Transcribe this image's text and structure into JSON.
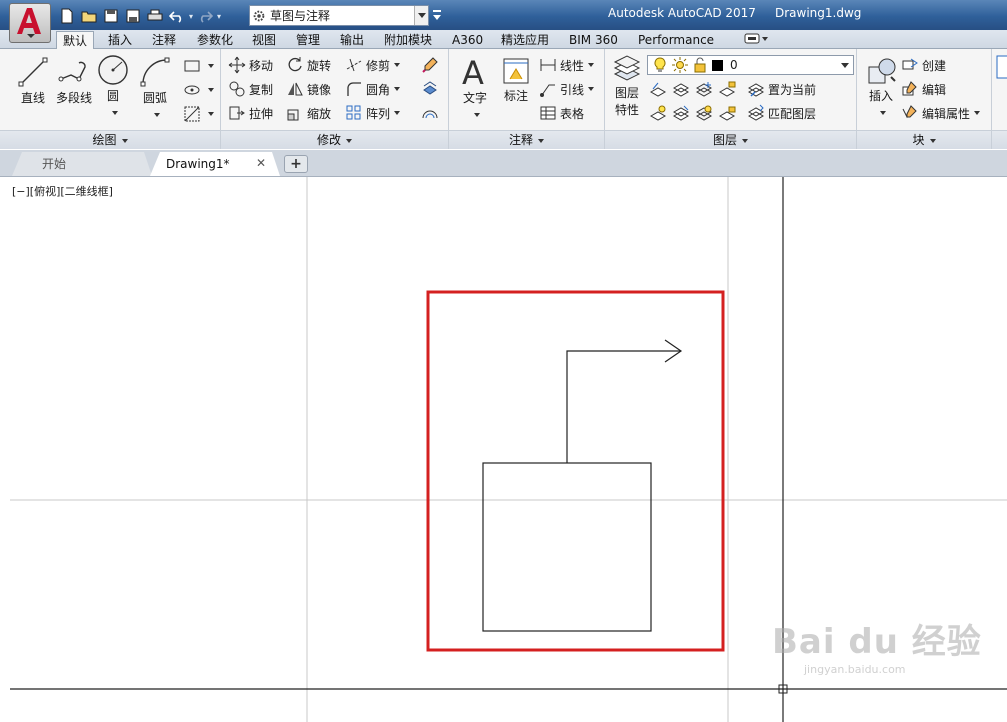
{
  "window": {
    "app_title": "Autodesk AutoCAD 2017",
    "document_title": "Drawing1.dwg"
  },
  "workspace": {
    "value": "草图与注释"
  },
  "ribbon_tabs": [
    "默认",
    "插入",
    "注释",
    "参数化",
    "视图",
    "管理",
    "输出",
    "附加模块",
    "A360",
    "精选应用",
    "BIM 360",
    "Performance"
  ],
  "active_tab": "默认",
  "panels": {
    "draw": {
      "title": "绘图",
      "line": "直线",
      "polyline": "多段线",
      "circle": "圆",
      "arc": "圆弧"
    },
    "modify": {
      "title": "修改",
      "move": "移动",
      "rotate": "旋转",
      "trim": "修剪",
      "copy": "复制",
      "mirror": "镜像",
      "fillet": "圆角",
      "stretch": "拉伸",
      "scale": "缩放",
      "array": "阵列"
    },
    "annotation": {
      "title": "注释",
      "text": "文字",
      "dimension": "标注",
      "linear": "线性",
      "leader": "引线",
      "table": "表格"
    },
    "layers": {
      "title": "图层",
      "properties_line1": "图层",
      "properties_line2": "特性",
      "layer_value": "0",
      "set_current": "置为当前",
      "match_layer": "匹配图层"
    },
    "block": {
      "title": "块",
      "insert": "插入",
      "create": "创建",
      "edit": "编辑",
      "edit_attributes": "编辑属性"
    }
  },
  "doc_tabs": {
    "start": "开始",
    "drawing": "Drawing1*",
    "close_glyph": "✕",
    "new_glyph": "+"
  },
  "viewport": {
    "label": "[−][俯视][二维线框]"
  },
  "watermark": {
    "brand": "Bai du 经验",
    "url": "jingyan.baidu.com"
  },
  "colors": {
    "title_bar": "#2f609a",
    "highlight_box": "#d42020",
    "accent": "#c8102e"
  }
}
